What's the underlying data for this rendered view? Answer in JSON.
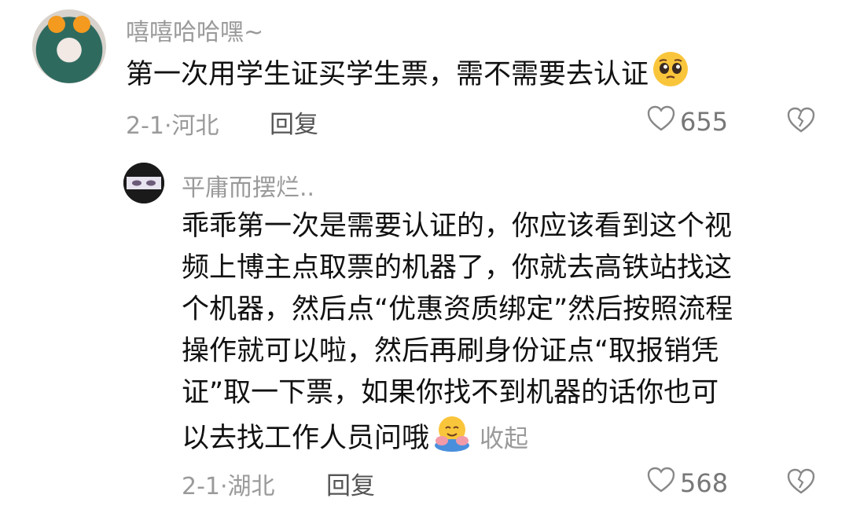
{
  "comment": {
    "username": "嘻嘻哈哈嘿~",
    "text": "第一次用学生证买学生票，需不需要去认证",
    "emoji": "pleading-face-icon",
    "date": "2-1·",
    "location": "河北",
    "reply_label": "回复",
    "likes": "655"
  },
  "reply": {
    "username": "平庸而摆烂..",
    "lines": [
      "乖乖第一次是需要认证的，你应该看到这个视",
      "频上博主点取票的机器了，你就去高铁站找这",
      "个机器，然后点“优惠资质绑定”然后按照流程",
      "操作就可以啦，然后再刷身份证点“取报销凭",
      "证”取一下票，如果你找不到机器的话你也可",
      "以去找工作人员问哦"
    ],
    "emoji": "hugging-face-icon",
    "collapse_label": "收起",
    "date": "2-1·",
    "location": "湖北",
    "reply_label": "回复",
    "likes": "568"
  }
}
